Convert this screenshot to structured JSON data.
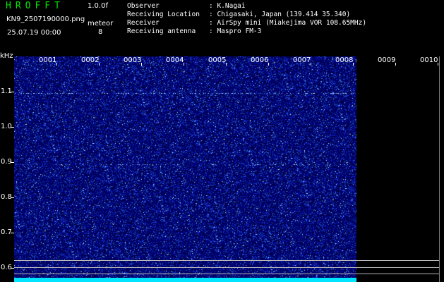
{
  "app": {
    "title": "HROFFT",
    "version": "1.0.0f"
  },
  "file": {
    "name": "KN9_2507190000.png",
    "timestamp": "25.07.19 00:00"
  },
  "meteor": {
    "label": "meteor",
    "count": "8"
  },
  "observation": {
    "labels": [
      "Observer",
      "Receiving Location",
      "Receiver",
      "Receiving antenna"
    ],
    "values": [
      ": K.Nagai",
      ": Chigasaki, Japan (139.414 35.340)",
      ": AirSpy mini (Miakejima VOR 108.65MHz)",
      ": Maspro FM-3"
    ]
  },
  "axis": {
    "unit": "kHz",
    "y_ticks": [
      "1.1",
      "1.0",
      "0.9",
      "0.8",
      "0.7",
      "0.6"
    ],
    "hours": [
      "0001",
      "0002",
      "0003",
      "0004",
      "0005",
      "0006",
      "0007",
      "0008",
      "0009",
      "0010"
    ]
  },
  "colors": {
    "title": "#00e600",
    "waterfall": "#00008c",
    "baseline": "#00e5ff"
  }
}
